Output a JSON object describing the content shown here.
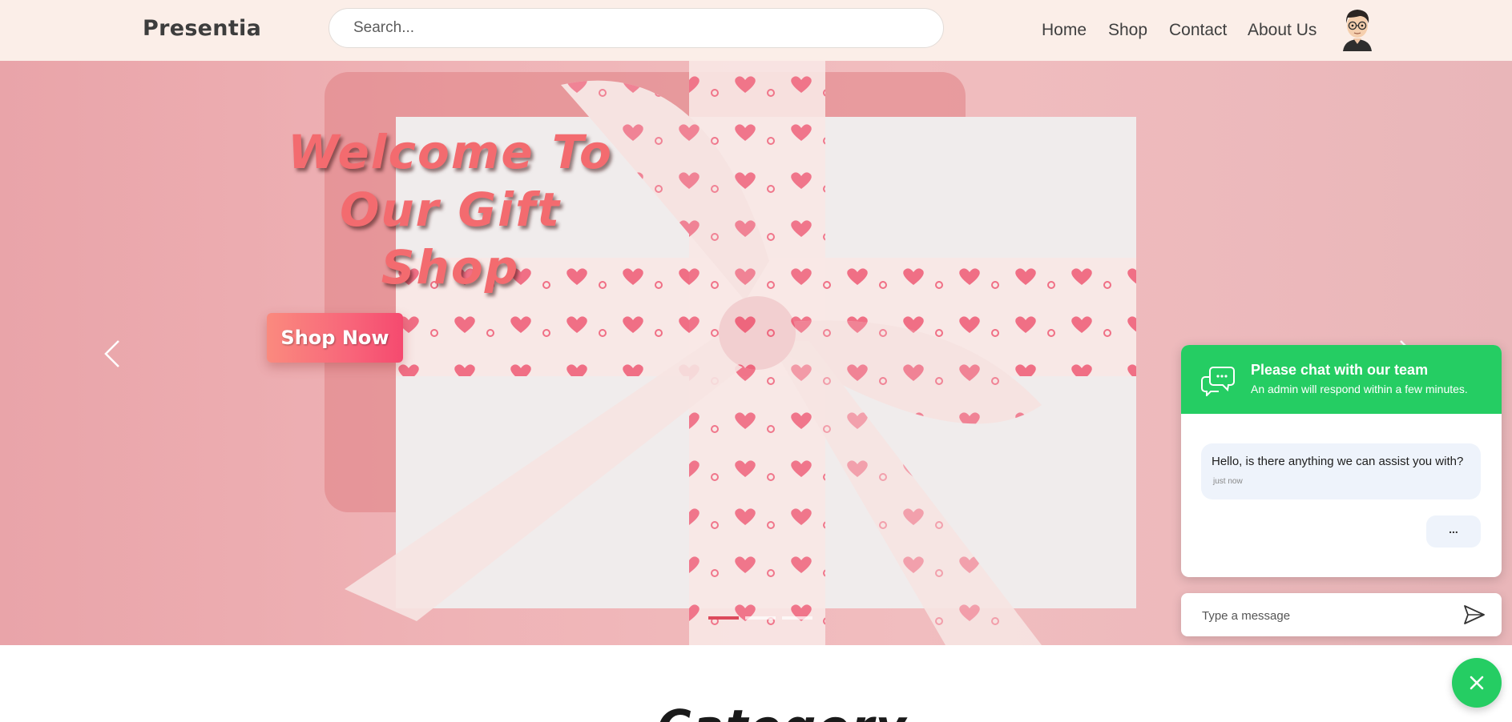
{
  "header": {
    "brand": "Presentia",
    "search_placeholder": "Search...",
    "nav": [
      "Home",
      "Shop",
      "Contact",
      "About Us"
    ]
  },
  "hero": {
    "title_line1": "Welcome To",
    "title_line2": "Our Gift Shop",
    "cta_label": "Shop Now",
    "slides_total": 3,
    "active_slide": 1
  },
  "category": {
    "title": "Category"
  },
  "chat": {
    "title": "Please chat with our team",
    "subtitle": "An admin will respond within a few minutes.",
    "message": "Hello, is there anything we can assist you with?",
    "message_time": "just now",
    "typing": "...",
    "input_placeholder": "Type a message"
  },
  "colors": {
    "header_bg": "#fbeee8",
    "accent_red": "#f36b6f",
    "chat_green": "#25cd63"
  }
}
